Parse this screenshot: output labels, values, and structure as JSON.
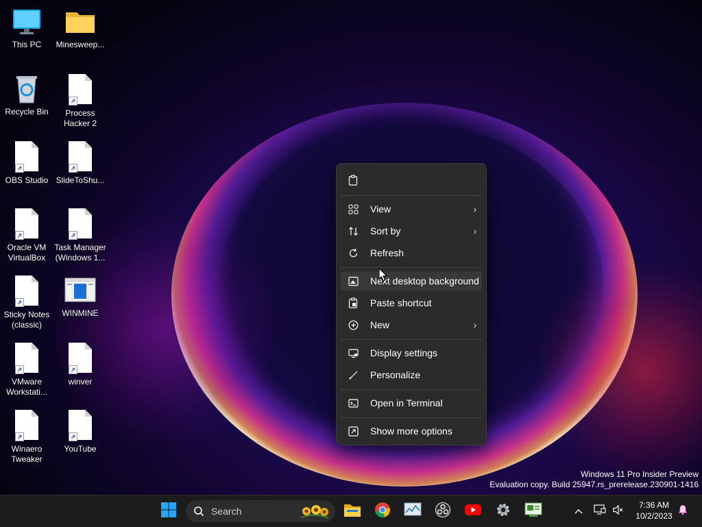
{
  "desktop": {
    "icons": [
      {
        "label": "This PC"
      },
      {
        "label": "Minesweep..."
      },
      {
        "label": "Recycle Bin"
      },
      {
        "label": "Process\nHacker 2"
      },
      {
        "label": "OBS Studio"
      },
      {
        "label": "SlideToShu..."
      },
      {
        "label": "Oracle VM\nVirtualBox"
      },
      {
        "label": "Task Manager\n(Windows 1..."
      },
      {
        "label": "Sticky Notes\n(classic)"
      },
      {
        "label": "WINMINE"
      },
      {
        "label": "VMware\nWorkstati..."
      },
      {
        "label": "winver"
      },
      {
        "label": "Winaero\nTweaker"
      },
      {
        "label": "YouTube"
      }
    ]
  },
  "context_menu": {
    "items": {
      "view": "View",
      "sort_by": "Sort by",
      "refresh": "Refresh",
      "next_bg": "Next desktop background",
      "paste_shortcut": "Paste shortcut",
      "new": "New",
      "display_settings": "Display settings",
      "personalize": "Personalize",
      "open_terminal": "Open in Terminal",
      "show_more": "Show more options"
    }
  },
  "watermark": {
    "line1": "Windows 11 Pro Insider Preview",
    "line2": "Evaluation copy. Build 25947.rs_prerelease.230901-1416"
  },
  "taskbar": {
    "search_label": "Search",
    "clock_time": "7:36 AM",
    "clock_date": "10/2/2023",
    "icons": [
      "windows-logo-icon",
      "search-icon",
      "file-explorer-icon",
      "chrome-icon",
      "resource-monitor-icon",
      "obs-icon",
      "youtube-icon",
      "settings-icon",
      "sysinternals-icon",
      "chevron-up-icon",
      "network-icon",
      "speaker-muted-icon",
      "bell-icon"
    ]
  },
  "colors": {
    "menu_bg": "#2b2b2b",
    "taskbar_bg": "#1c1c1c",
    "accent": "#0078d4"
  }
}
